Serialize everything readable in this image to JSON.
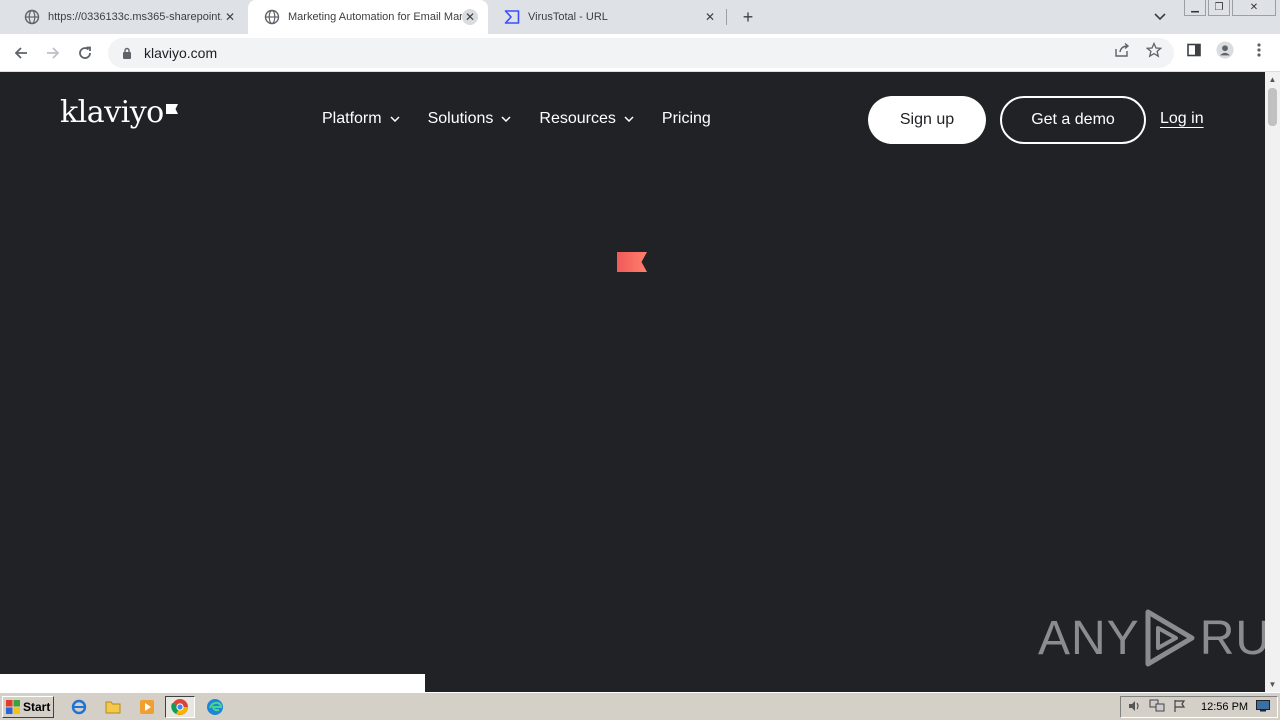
{
  "browser": {
    "tabs": [
      {
        "title": "https://0336133c.ms365-sharepoint.",
        "icon": "globe-icon",
        "active": false
      },
      {
        "title": "Marketing Automation for Email Mark",
        "icon": "globe-icon",
        "active": true
      },
      {
        "title": "VirusTotal - URL",
        "icon": "virustotal-icon",
        "active": false
      }
    ],
    "url": "klaviyo.com"
  },
  "page": {
    "logo_text": "klaviyo",
    "nav": [
      {
        "label": "Platform",
        "has_dropdown": true
      },
      {
        "label": "Solutions",
        "has_dropdown": true
      },
      {
        "label": "Resources",
        "has_dropdown": true
      },
      {
        "label": "Pricing",
        "has_dropdown": false
      }
    ],
    "signup_label": "Sign up",
    "demo_label": "Get a demo",
    "login_label": "Log in",
    "colors": {
      "background": "#202226",
      "accent": "#f05a5a"
    }
  },
  "watermark": {
    "left": "ANY",
    "right": "RUN"
  },
  "taskbar": {
    "start_label": "Start",
    "clock": "12:56 PM"
  }
}
